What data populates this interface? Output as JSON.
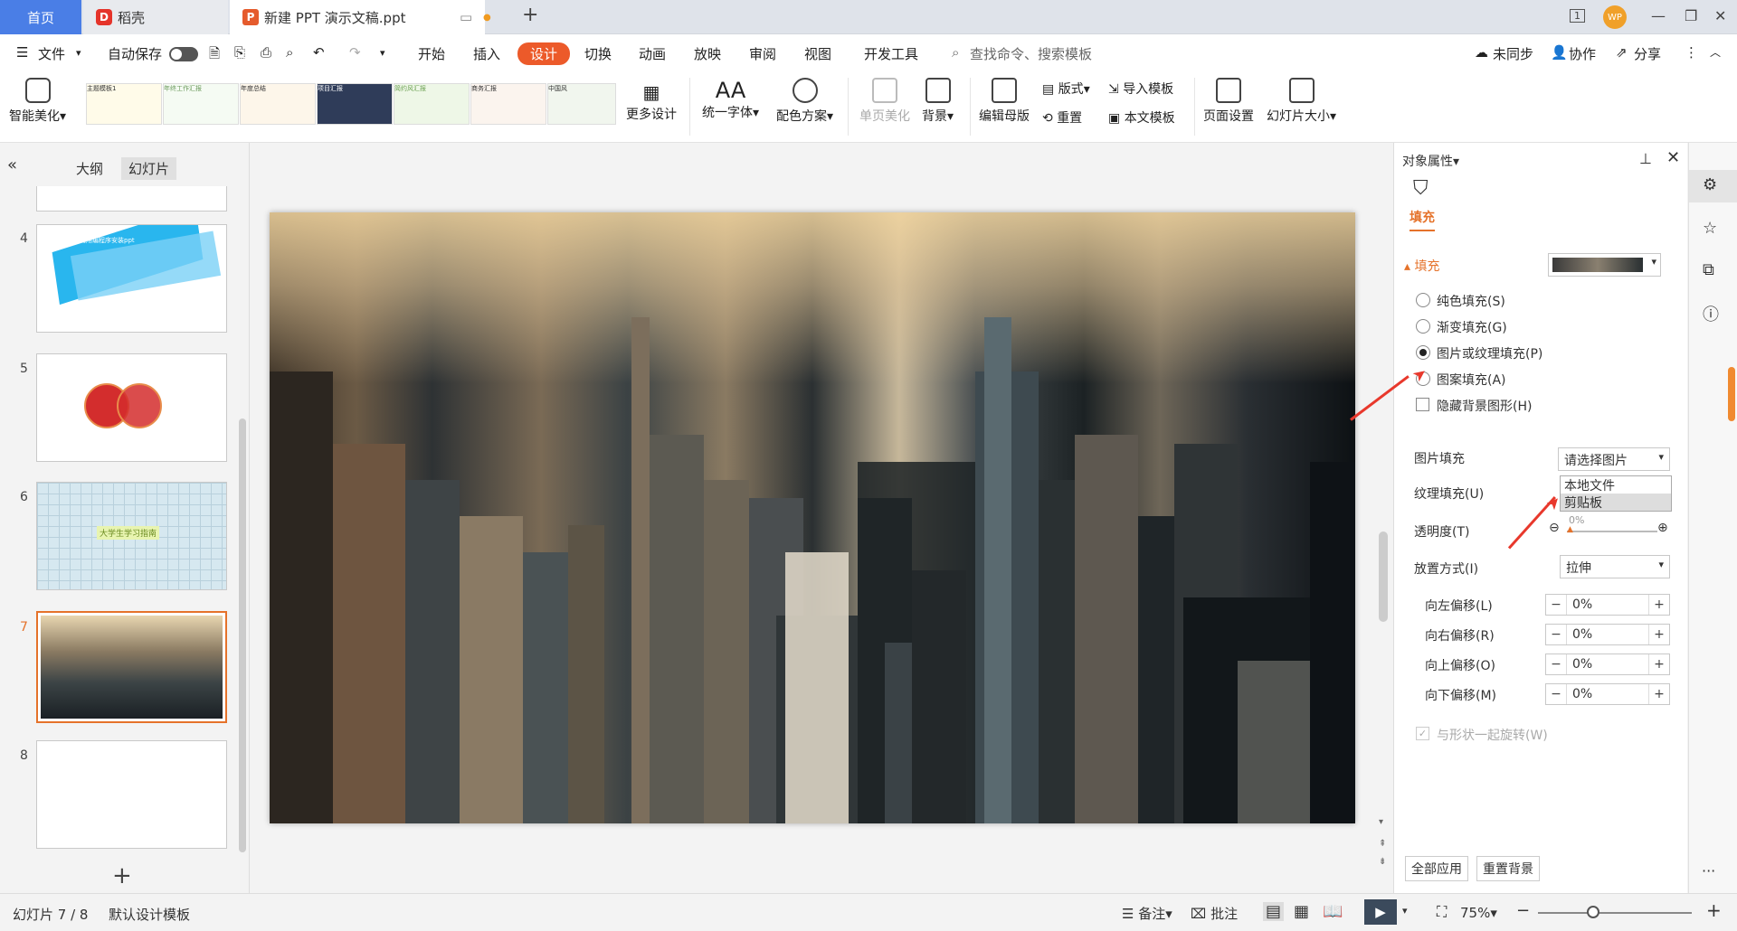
{
  "titlebar": {
    "tab_home": "首页",
    "tab_daoke": "稻壳",
    "tab_doc": "新建 PPT 演示文稿.ppt",
    "new_tab": "+",
    "page_badge": "1",
    "avatar": "WP"
  },
  "menubar": {
    "file": "文件",
    "autosave": "自动保存",
    "items": [
      "开始",
      "插入",
      "设计",
      "切换",
      "动画",
      "放映",
      "审阅",
      "视图",
      "开发工具"
    ],
    "search": "查找命令、搜索模板",
    "sync": "未同步",
    "collab": "协作",
    "share": "分享"
  },
  "ribbon": {
    "smart": "智能美化",
    "more_design": "更多设计",
    "font": "统一字体",
    "color": "配色方案",
    "single": "单页美化",
    "background": "背景",
    "edit_master": "编辑母版",
    "layout": "版式",
    "reset": "重置",
    "import": "导入模板",
    "this_template": "本文模板",
    "page_setup": "页面设置",
    "slide_size": "幻灯片大小",
    "thumbs": [
      "主题模板1",
      "年终工作汇报",
      "年度总结",
      "项目汇报",
      "简约风汇报",
      "商务汇报",
      "中国风"
    ]
  },
  "leftpanel": {
    "tab_outline": "大纲",
    "tab_slides": "幻灯片",
    "slides": [
      {
        "num": "4",
        "text": "如何用编程序安装ppt"
      },
      {
        "num": "5",
        "text": ""
      },
      {
        "num": "6",
        "text": "大学生学习指南"
      },
      {
        "num": "7",
        "text": ""
      },
      {
        "num": "8",
        "text": ""
      }
    ],
    "add": "+"
  },
  "rightpanel": {
    "title": "对象属性",
    "tab_fill": "填充",
    "section_fill": "填充",
    "options": [
      "纯色填充(S)",
      "渐变填充(G)",
      "图片或纹理填充(P)",
      "图案填充(A)"
    ],
    "hide_bg": "隐藏背景图形(H)",
    "picture_fill": "图片填充",
    "picture_fill_value": "请选择图片",
    "dropdown_items": [
      "本地文件",
      "剪贴板"
    ],
    "texture_fill": "纹理填充(U)",
    "transparency": "透明度(T)",
    "transparency_value": "0%",
    "placement": "放置方式(I)",
    "placement_value": "拉伸",
    "offsets": [
      {
        "label": "向左偏移(L)",
        "value": "0%"
      },
      {
        "label": "向右偏移(R)",
        "value": "0%"
      },
      {
        "label": "向上偏移(O)",
        "value": "0%"
      },
      {
        "label": "向下偏移(M)",
        "value": "0%"
      }
    ],
    "rotate_with_shape": "与形状一起旋转(W)",
    "apply_all": "全部应用",
    "reset_bg": "重置背景"
  },
  "statusbar": {
    "slide_info": "幻灯片 7 / 8",
    "template": "默认设计模板",
    "notes": "备注",
    "comments": "批注",
    "zoom": "75%"
  },
  "colors": {
    "accent": "#ec5a2a",
    "home_tab": "#4a7ee6",
    "arrow": "#e8382c"
  }
}
